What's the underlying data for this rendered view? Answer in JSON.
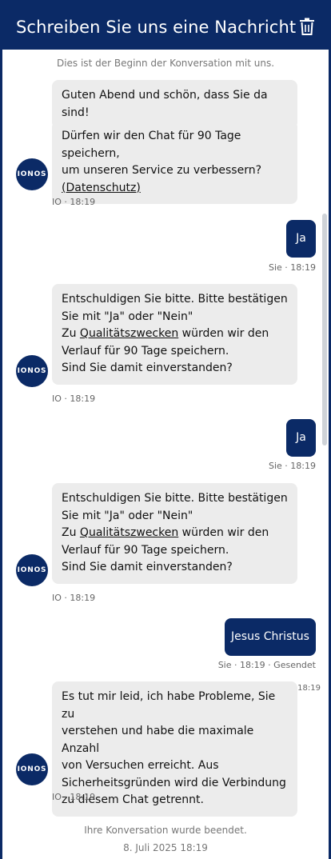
{
  "header": {
    "title": "Schreiben Sie uns eine Nachricht",
    "delete_icon": "trash-icon"
  },
  "conversation_start": "Dies ist der Beginn der Konversation mit uns.",
  "avatar_text": "IONOS",
  "messages": [
    {
      "greeting": "Guten Abend und schön, dass Sie da sind!",
      "consent_line1": "Dürfen wir den Chat für 90 Tage speichern,",
      "consent_line2": "um unseren Service zu verbessern?",
      "privacy_link": "(Datenschutz)",
      "meta": "IO · 18:19"
    },
    {
      "text": "Ja",
      "meta": "Sie · 18:19"
    },
    {
      "line1": "Entschuldigen Sie bitte. Bitte bestätigen",
      "line2": "Sie mit \"Ja\" oder \"Nein\"",
      "line3_prefix": "Zu ",
      "link": "Qualitätszwecken",
      "line3_suffix": " würden wir den",
      "line4": "Verlauf für 90 Tage speichern.",
      "line5": "Sind Sie damit einverstanden?",
      "meta": "IO · 18:19"
    },
    {
      "text": "Ja",
      "meta": "Sie · 18:19"
    },
    {
      "line1": "Entschuldigen Sie bitte. Bitte bestätigen",
      "line2": "Sie mit \"Ja\" oder \"Nein\"",
      "line3_prefix": "Zu ",
      "link": "Qualitätszwecken",
      "line3_suffix": " würden wir den",
      "line4": "Verlauf für 90 Tage speichern.",
      "line5": "Sind Sie damit einverstanden?",
      "meta": "IO · 18:19"
    },
    {
      "text": "Jesus Christus",
      "meta": "Sie · 18:19 · Gesendet"
    },
    {
      "line1": "Es tut mir leid, ich habe Probleme, Sie zu",
      "line2": "verstehen und habe die maximale Anzahl",
      "line3": "von Versuchen erreicht. Aus",
      "line4": "Sicherheitsgründen wird die Verbindung",
      "line5": "zu diesem Chat getrennt.",
      "meta": "IO · 18:19",
      "extra_time": "18:19"
    }
  ],
  "end": {
    "text": "Ihre Konversation wurde beendet.",
    "date": "8. Juli 2025 18:19"
  }
}
